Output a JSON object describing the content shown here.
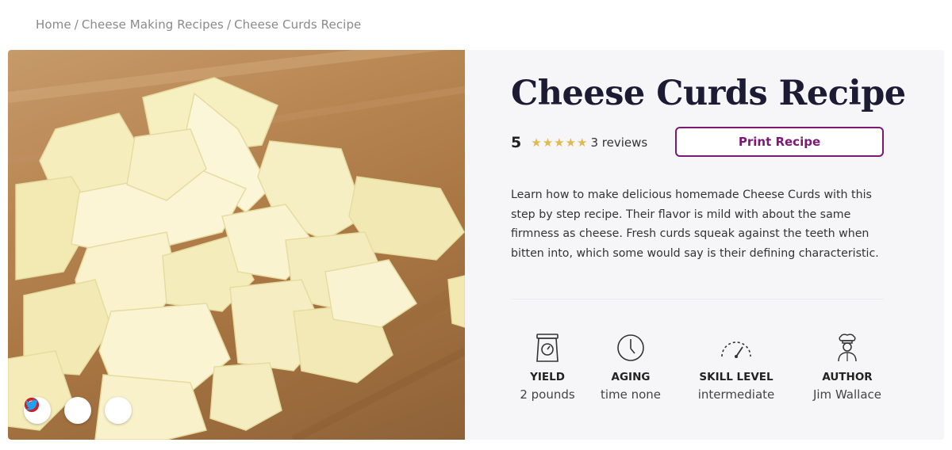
{
  "breadcrumb": {
    "items": [
      "Home",
      "Cheese Making Recipes",
      "Cheese Curds Recipe"
    ],
    "separator": "/"
  },
  "recipe": {
    "title": "Cheese Curds Recipe",
    "rating": "5",
    "stars": 5,
    "reviews": "3 reviews",
    "print_label": "Print Recipe",
    "description": "Learn how to make delicious homemade Cheese Curds with this step by step recipe. Their flavor is mild with about the same firmness as cheese. Fresh curds squeak against the teeth when bitten into, which some would say is their defining characteristic."
  },
  "meta": [
    {
      "icon": "scale-icon",
      "label": "YIELD",
      "value": "2 pounds"
    },
    {
      "icon": "clock-icon",
      "label": "AGING",
      "value": "time none"
    },
    {
      "icon": "gauge-icon",
      "label": "SKILL LEVEL",
      "value": "intermediate"
    },
    {
      "icon": "chef-icon",
      "label": "AUTHOR",
      "value": "Jim Wallace"
    }
  ],
  "social": [
    {
      "icon": "facebook-icon",
      "color": "#3b5998"
    },
    {
      "icon": "pinterest-icon",
      "color": "#cb2027"
    },
    {
      "icon": "twitter-icon",
      "color": "#1da1f2"
    }
  ],
  "colors": {
    "accent": "#7a1a73",
    "title": "#1d1a33",
    "star": "#e2b94f",
    "card_bg": "#f6f6f8"
  }
}
